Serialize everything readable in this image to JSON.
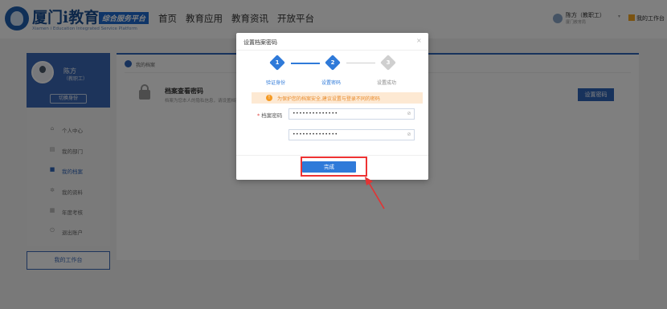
{
  "header": {
    "logo_text": "厦门i教育",
    "logo_tag": "综合服务平台",
    "logo_en": "Xiamen i Education Integrated Service Platform",
    "nav": [
      "首页",
      "教育应用",
      "教育资讯",
      "开放平台"
    ],
    "user": {
      "name": "陈方（教职工）",
      "subtitle": "厦门教育局",
      "workbench": "我的工作台"
    }
  },
  "sidebar": {
    "profile": {
      "name": "陈方",
      "role": "（教职工）",
      "switch_label": "切换身份"
    },
    "items": [
      {
        "label": "个人中心",
        "icon": "home-icon",
        "active": false
      },
      {
        "label": "我的部门",
        "icon": "building-icon",
        "active": false
      },
      {
        "label": "我的档案",
        "icon": "folder-icon",
        "active": true
      },
      {
        "label": "我的资料",
        "icon": "gear-icon",
        "active": false
      },
      {
        "label": "年度考核",
        "icon": "calendar-icon",
        "active": false
      },
      {
        "label": "退出账户",
        "icon": "logout-icon",
        "active": false
      }
    ],
    "workbench_button": "我的工作台"
  },
  "main": {
    "breadcrumb": "我的档案",
    "archive_title": "档案查看密码",
    "archive_desc": "档案为您本人的隐私信息，请设置档案查看密码",
    "set_password_button": "设置密码"
  },
  "modal": {
    "title": "设置档案密码",
    "close": "×",
    "steps": [
      {
        "number": "1",
        "label": "验证身份",
        "state": "done"
      },
      {
        "number": "2",
        "label": "设置密码",
        "state": "done"
      },
      {
        "number": "3",
        "label": "设置成功",
        "state": "todo"
      }
    ],
    "notice": "为保护您的档案安全,建议设置与登录不同的密码",
    "field_label": "档案密码",
    "password_value": "••••••••••••••",
    "confirm_value": "••••••••••••••",
    "done_button": "完成"
  },
  "colors": {
    "primary": "#2f7ad9",
    "brand": "#2f64b8",
    "warning": "#f59a23",
    "annotation": "#e33333"
  }
}
